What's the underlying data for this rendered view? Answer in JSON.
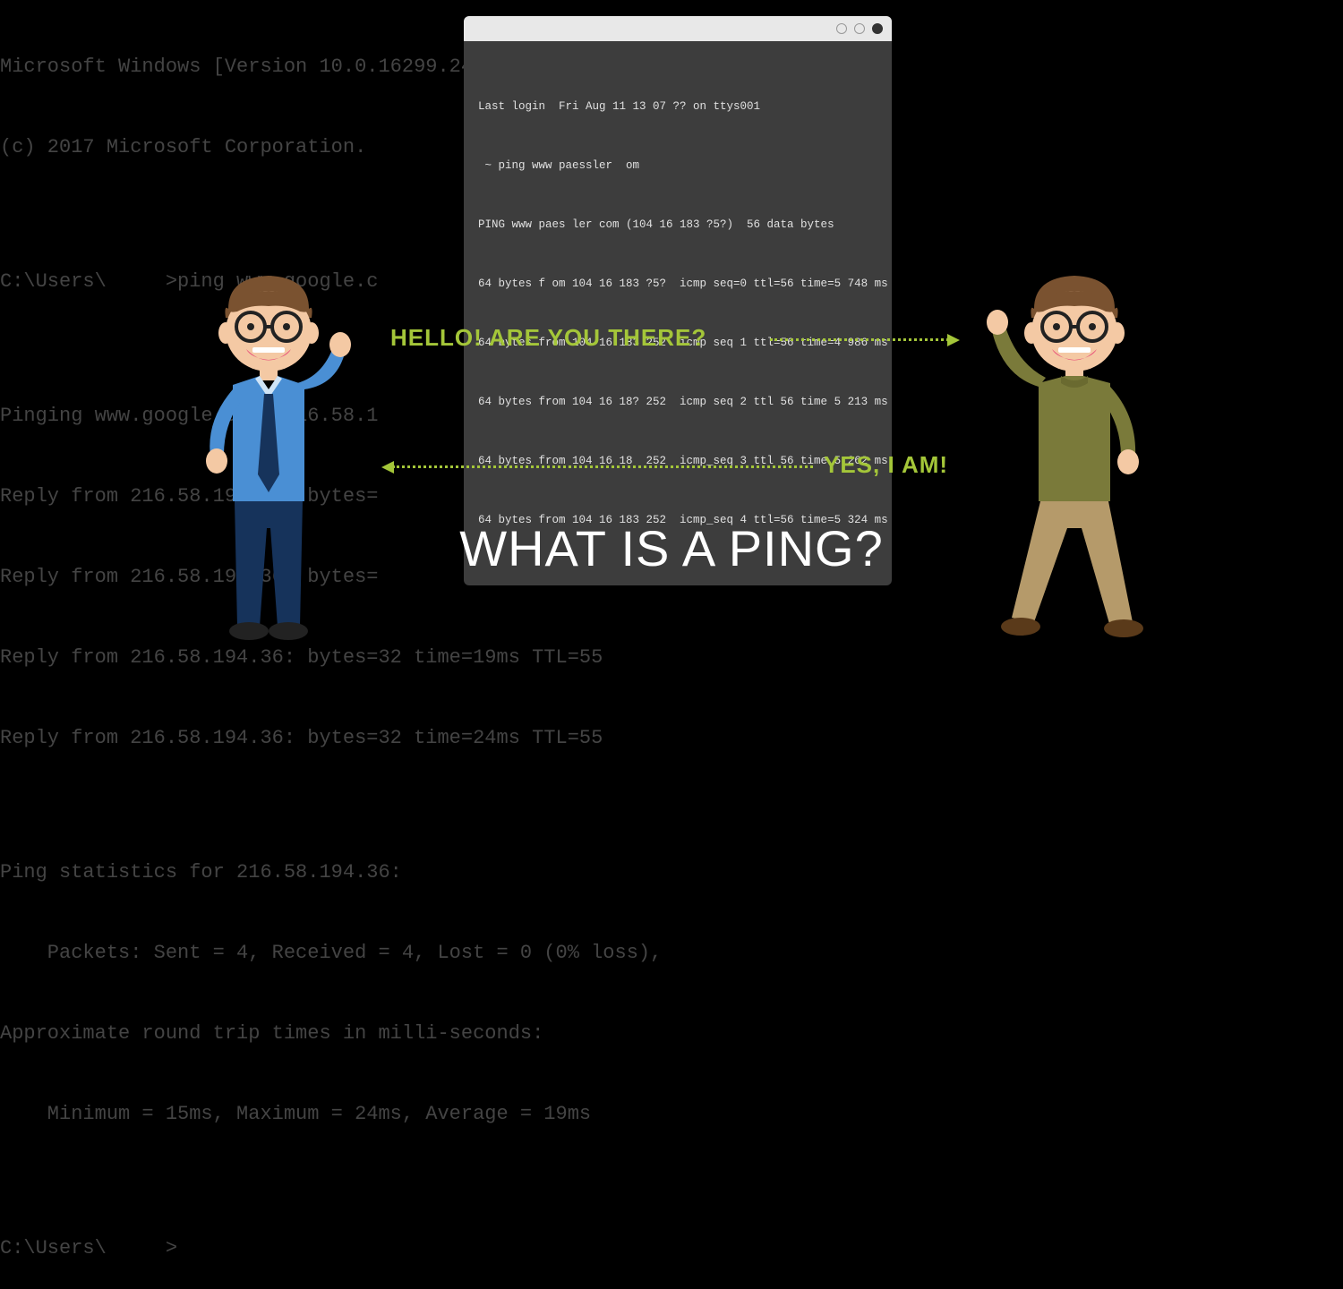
{
  "background_terminal": {
    "lines": [
      "Microsoft Windows [Version 10.0.16299.248]",
      "(c) 2017 Microsoft Corporation.",
      "",
      "C:\\Users\\     >ping www.google.c",
      "",
      "Pinging www.google.com [216.58.1",
      "Reply from 216.58.194.36: bytes=",
      "Reply from 216.58.194.36: bytes=",
      "Reply from 216.58.194.36: bytes=32 time=19ms TTL=55",
      "Reply from 216.58.194.36: bytes=32 time=24ms TTL=55",
      "",
      "Ping statistics for 216.58.194.36:",
      "    Packets: Sent = 4, Received = 4, Lost = 0 (0% loss),",
      "Approximate round trip times in milli-seconds:",
      "    Minimum = 15ms, Maximum = 24ms, Average = 19ms",
      "",
      "C:\\Users\\     >"
    ]
  },
  "mac_terminal": {
    "lines": [
      "Last login  Fri Aug 11 13 07 ?? on ttys001",
      " ~ ping www paessler  om",
      "PING www paes ler com (104 16 183 ?5?)  56 data bytes",
      "64 bytes f om 104 16 183 ?5?  icmp seq=0 ttl=56 time=5 748 ms",
      "64 bytes from 104 16 183 252  icmp seq 1 ttl=56 time=4 986 ms",
      "64 bytes from 104 16 18? 252  icmp seq 2 ttl 56 time 5 213 ms",
      "64 bytes from 104 16 18  252  icmp_seq 3 ttl 56 time 5 262 ms",
      "64 bytes from 104 16 183 252  icmp_seq 4 ttl=56 time=5 324 ms"
    ]
  },
  "speech": {
    "hello": "HELLO! ARE YOU THERE?",
    "yes": "YES, I AM!"
  },
  "title": "WHAT IS A PING?"
}
